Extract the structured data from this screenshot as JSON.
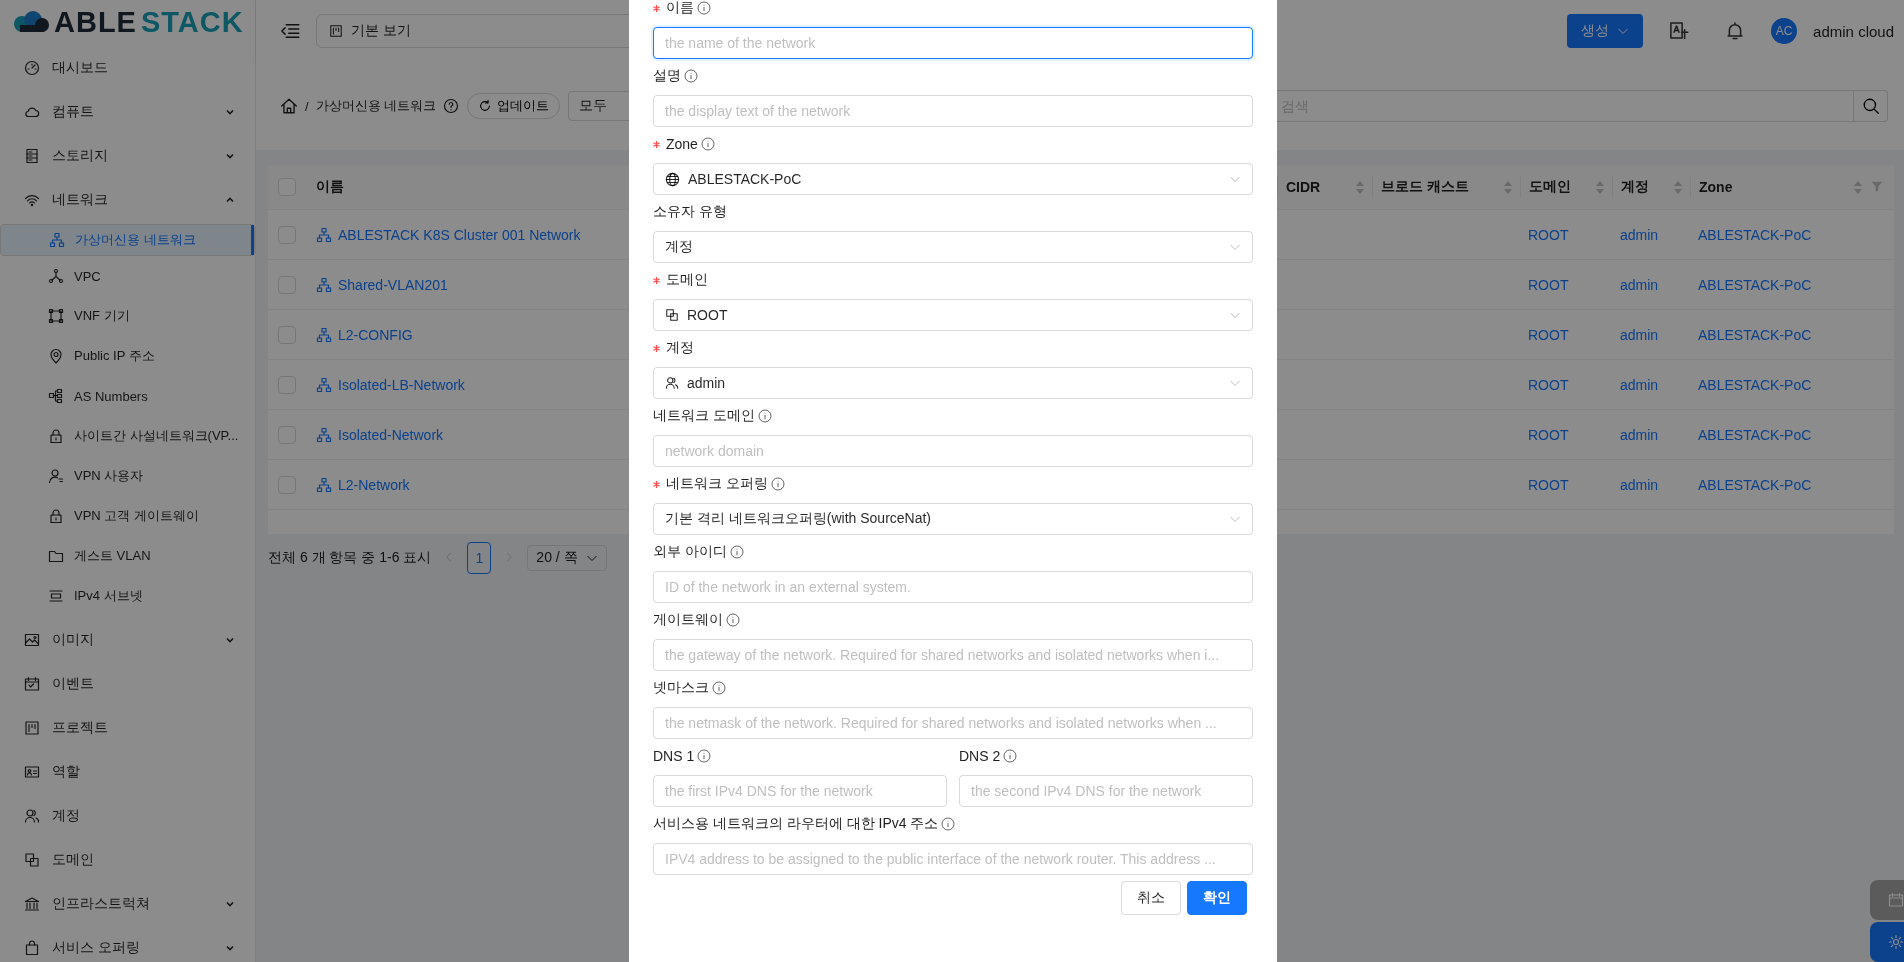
{
  "sidebar": {
    "logo": {
      "text": "ABLE",
      "accent": "STACK"
    },
    "items": [
      {
        "label": "대시보드",
        "selected": false
      },
      {
        "label": "컴퓨트",
        "selected": false,
        "expanded": false
      },
      {
        "label": "스토리지",
        "selected": false,
        "expanded": false
      },
      {
        "label": "네트워크",
        "selected": false,
        "expanded": true,
        "children": [
          {
            "label": "가상머신용 네트워크",
            "selected": true
          },
          {
            "label": "VPC",
            "selected": false
          },
          {
            "label": "VNF 기기",
            "selected": false
          },
          {
            "label": "Public IP 주소",
            "selected": false
          },
          {
            "label": "AS Numbers",
            "selected": false
          },
          {
            "label": "사이트간 사설네트워크(VP...",
            "selected": false
          },
          {
            "label": "VPN 사용자",
            "selected": false
          },
          {
            "label": "VPN 고객 게이트웨이",
            "selected": false
          },
          {
            "label": "게스트 VLAN",
            "selected": false
          },
          {
            "label": "IPv4 서브넷",
            "selected": false
          }
        ]
      },
      {
        "label": "이미지",
        "selected": false,
        "expanded": false
      },
      {
        "label": "이벤트",
        "selected": false
      },
      {
        "label": "프로젝트",
        "selected": false
      },
      {
        "label": "역할",
        "selected": false
      },
      {
        "label": "계정",
        "selected": false
      },
      {
        "label": "도메인",
        "selected": false
      },
      {
        "label": "인프라스트럭쳐",
        "selected": false,
        "expanded": false
      },
      {
        "label": "서비스 오퍼링",
        "selected": false,
        "expanded": false
      }
    ]
  },
  "header": {
    "view_select": "기본 보기",
    "create_button": "생성",
    "avatar": "AC",
    "user": "admin cloud"
  },
  "toolbar": {
    "separator": "/",
    "breadcrumb": "가상머신용 네트워크",
    "refresh_button": "업데이트",
    "filter": "모두",
    "search_placeholder": "검색"
  },
  "table": {
    "all_checked": false,
    "columns": [
      {
        "label": "이름",
        "sortable": false
      },
      {
        "label": "CIDR",
        "sortable": true
      },
      {
        "label": "브로드 캐스트",
        "sortable": true
      },
      {
        "label": "도메인",
        "sortable": true
      },
      {
        "label": "계정",
        "sortable": true
      },
      {
        "label": "Zone",
        "sortable": true
      }
    ],
    "rows": [
      {
        "checked": false,
        "name": "ABLESTACK K8S Cluster 001 Network",
        "domain": "ROOT",
        "account": "admin",
        "zone": "ABLESTACK-PoC"
      },
      {
        "checked": false,
        "name": "Shared-VLAN201",
        "domain": "ROOT",
        "account": "admin",
        "zone": "ABLESTACK-PoC"
      },
      {
        "checked": false,
        "name": "L2-CONFIG",
        "domain": "ROOT",
        "account": "admin",
        "zone": "ABLESTACK-PoC"
      },
      {
        "checked": false,
        "name": "Isolated-LB-Network",
        "domain": "ROOT",
        "account": "admin",
        "zone": "ABLESTACK-PoC"
      },
      {
        "checked": false,
        "name": "Isolated-Network",
        "domain": "ROOT",
        "account": "admin",
        "zone": "ABLESTACK-PoC"
      },
      {
        "checked": false,
        "name": "L2-Network",
        "domain": "ROOT",
        "account": "admin",
        "zone": "ABLESTACK-PoC"
      }
    ]
  },
  "pagination": {
    "summary": "전체 6 개 항목 중 1-6 표시",
    "pages": [
      {
        "label": "1",
        "selected": true
      }
    ],
    "page_size": "20 / 쪽"
  },
  "dialog": {
    "fields": [
      {
        "kind": "input",
        "label": "이름",
        "required": true,
        "info": true,
        "placeholder": "the name of the network",
        "focused": true
      },
      {
        "kind": "input",
        "label": "설명",
        "required": false,
        "info": true,
        "placeholder": "the display text of the network",
        "focused": false
      },
      {
        "kind": "select",
        "label": "Zone",
        "required": true,
        "info": true,
        "value": "ABLESTACK-PoC"
      },
      {
        "kind": "select",
        "label": "소유자 유형",
        "required": false,
        "info": false,
        "value": "계정"
      },
      {
        "kind": "select",
        "label": "도메인",
        "required": true,
        "info": false,
        "value": "ROOT"
      },
      {
        "kind": "select",
        "label": "계정",
        "required": true,
        "info": false,
        "value": "admin"
      },
      {
        "kind": "input",
        "label": "네트워크 도메인",
        "required": false,
        "info": true,
        "placeholder": "network domain",
        "focused": false
      },
      {
        "kind": "select",
        "label": "네트워크 오퍼링",
        "required": true,
        "info": true,
        "value": "기본 격리 네트워크오퍼링(with SourceNat)"
      },
      {
        "kind": "input",
        "label": "외부 아이디",
        "required": false,
        "info": true,
        "placeholder": "ID of the network in an external system.",
        "focused": false
      },
      {
        "kind": "input",
        "label": "게이트웨이",
        "required": false,
        "info": true,
        "placeholder": "the gateway of the network. Required for shared networks and isolated networks when i...",
        "focused": false
      },
      {
        "kind": "input",
        "label": "넷마스크",
        "required": false,
        "info": true,
        "placeholder": "the netmask of the network. Required for shared networks and isolated networks when ...",
        "focused": false
      },
      {
        "kind": "pair",
        "items": [
          {
            "label": "DNS 1",
            "required": false,
            "info": true,
            "placeholder": "the first IPv4 DNS for the network",
            "focused": false
          },
          {
            "label": "DNS 2",
            "required": false,
            "info": true,
            "placeholder": "the second IPv4 DNS for the network",
            "focused": false
          }
        ]
      },
      {
        "kind": "input",
        "label": "서비스용 네트워크의 라우터에 대한 IPv4 주소",
        "required": false,
        "info": true,
        "placeholder": "IPV4 address to be assigned to the public interface of the network router. This address ...",
        "focused": false
      }
    ],
    "buttons": [
      {
        "label": "취소",
        "primary": false
      },
      {
        "label": "확인",
        "primary": true
      }
    ]
  }
}
